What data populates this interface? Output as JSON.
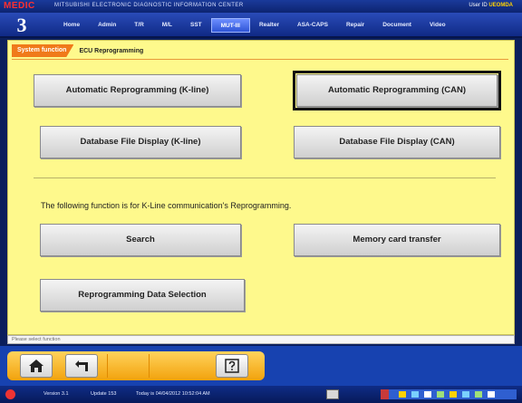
{
  "title_bar": {
    "brand": "MEDIC",
    "app_title": "MITSUBISHI ELECTRONIC DIAGNOSTIC INFORMATION CENTER",
    "user_label": "User ID",
    "user_id": "UEOMDA"
  },
  "nav": {
    "logo": "3",
    "tabs": [
      {
        "label": "Home"
      },
      {
        "label": "Admin"
      },
      {
        "label": "T/R"
      },
      {
        "label": "M/L"
      },
      {
        "label": "SST"
      },
      {
        "label": "MUT-III"
      },
      {
        "label": "Realter"
      },
      {
        "label": "ASA-CAPS"
      },
      {
        "label": "Repair"
      },
      {
        "label": "Document"
      },
      {
        "label": "Video"
      }
    ],
    "active_tab": "MUT-III"
  },
  "breadcrumb": {
    "active": "System function",
    "current": "ECU Reprogramming"
  },
  "buttons": {
    "auto_kline": "Automatic Reprogramming (K-line)",
    "auto_can": "Automatic Reprogramming (CAN)",
    "db_kline": "Database File Display (K-line)",
    "db_can": "Database File Display (CAN)",
    "search": "Search",
    "memory_card": "Memory card transfer",
    "data_selection": "Reprogramming Data Selection"
  },
  "info_text": "The following function is for K-Line communication's Reprogramming.",
  "status_line": "Please select function",
  "toolbar": {
    "icons": [
      "home-icon",
      "return-icon",
      "help-icon"
    ]
  },
  "status_bar": {
    "version": "Version 3.1",
    "update": "Update 153",
    "datetime": "Today is 04/04/2012 10:52:04 AM"
  },
  "colors": {
    "content_bg": "#fef98c",
    "nav_bg": "#1a3a9a",
    "breadcrumb_accent": "#f07a1a",
    "toolbar_accent": "#f2a20c"
  }
}
